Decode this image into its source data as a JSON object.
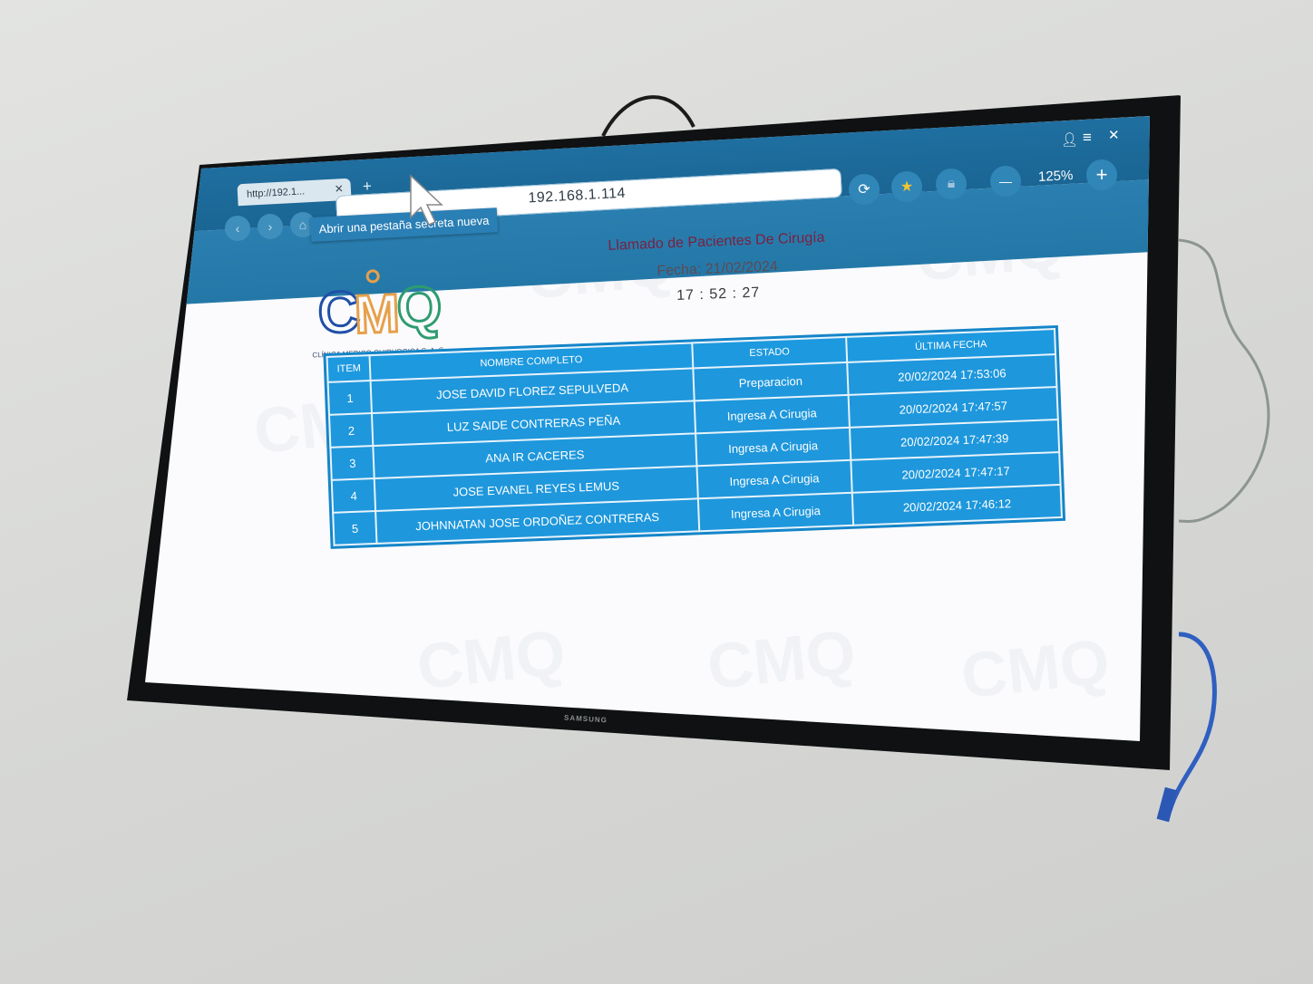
{
  "browser": {
    "tab_title": "http://192.1...",
    "tab_close": "✕",
    "new_tab": "+",
    "url": "192.168.1.114",
    "zoom_level": "125%",
    "zoom_out": "—",
    "zoom_in": "+",
    "tooltip": "Abrir una pestaña secreta nueva",
    "window_close": "✕",
    "menu_icon": "≡",
    "user_icon": "user-icon"
  },
  "page": {
    "title": "Llamado de Pacientes De Cirugía",
    "date": "Fecha: 21/02/2024",
    "clock": "17 : 52 : 27",
    "logo_text": "CMQ",
    "logo_subtitle": "CLÍNICA MEDICO QUIRURGICA S. A. S."
  },
  "table": {
    "headers": [
      "ITEM",
      "NOMBRE COMPLETO",
      "ESTADO",
      "ÚLTIMA FECHA"
    ],
    "rows": [
      {
        "item": "1",
        "name": "JOSE DAVID FLOREZ SEPULVEDA",
        "estado": "Preparacion",
        "fecha": "20/02/2024 17:53:06"
      },
      {
        "item": "2",
        "name": "LUZ SAIDE CONTRERAS PEÑA",
        "estado": "Ingresa A Cirugia",
        "fecha": "20/02/2024 17:47:57"
      },
      {
        "item": "3",
        "name": "ANA IR CACERES",
        "estado": "Ingresa A Cirugia",
        "fecha": "20/02/2024 17:47:39"
      },
      {
        "item": "4",
        "name": "JOSE EVANEL REYES LEMUS",
        "estado": "Ingresa A Cirugia",
        "fecha": "20/02/2024 17:47:17"
      },
      {
        "item": "5",
        "name": "JOHNNATAN JOSE ORDOÑEZ CONTRERAS",
        "estado": "Ingresa A Cirugia",
        "fecha": "20/02/2024 17:46:12"
      }
    ]
  },
  "tv": {
    "brand": "SAMSUNG"
  },
  "colors": {
    "chrome": "#1f6fa0",
    "table_blue": "#1e97dc",
    "title": "#7a2140"
  }
}
